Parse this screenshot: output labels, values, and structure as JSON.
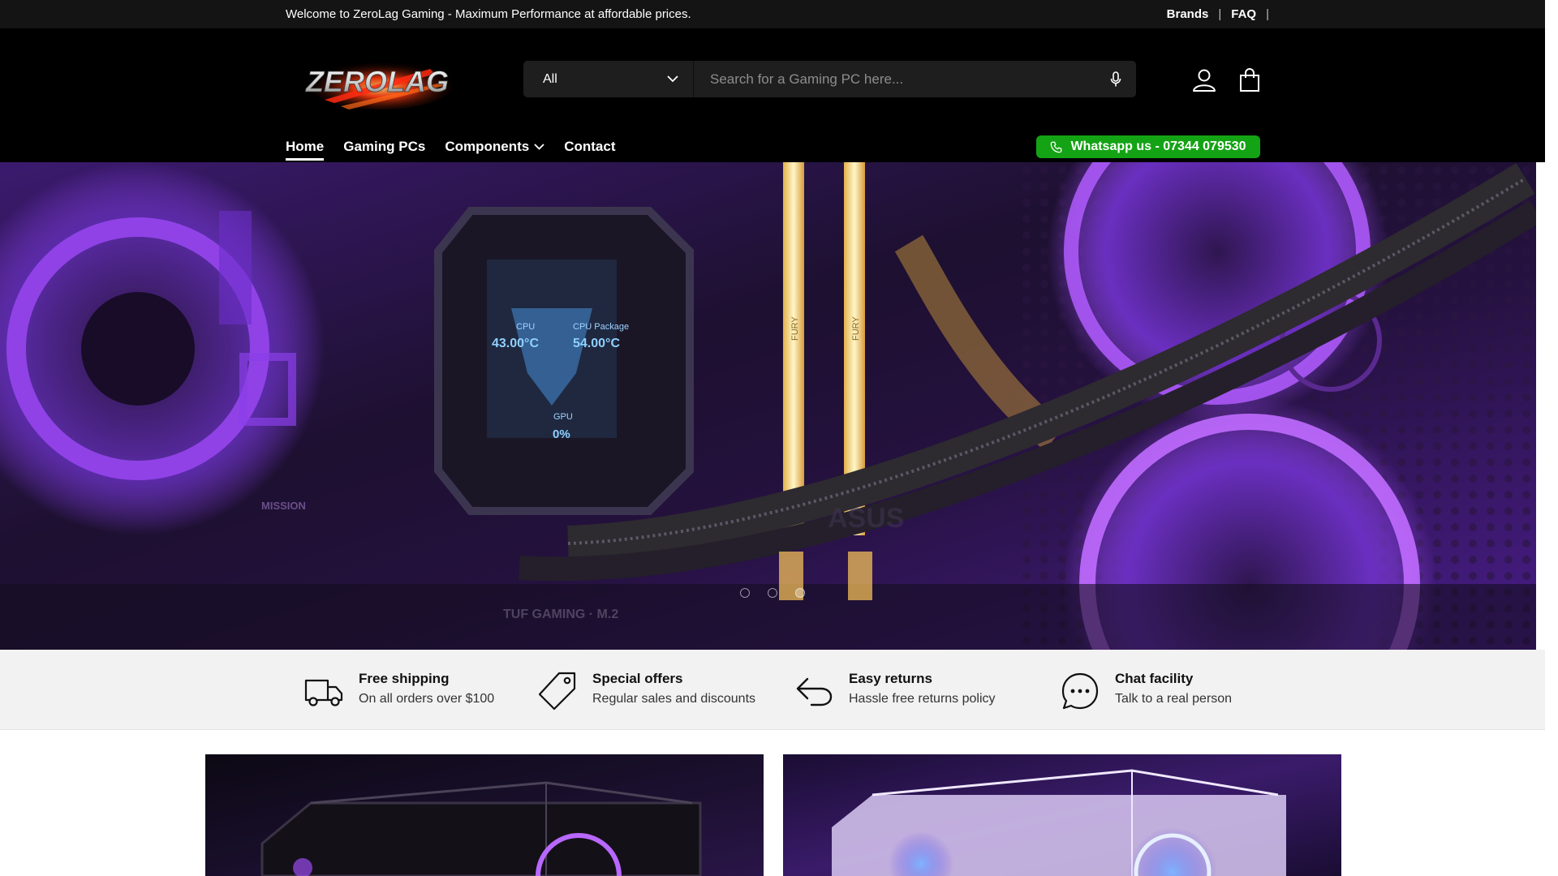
{
  "topbar": {
    "welcome": "Welcome to ZeroLag Gaming - Maximum Performance at affordable prices.",
    "links": [
      "Brands",
      "FAQ"
    ]
  },
  "brand": {
    "logo_text": "ZEROLAG",
    "accent": "#ff2a12",
    "whatsapp_green": "#14a314"
  },
  "search": {
    "category": "All",
    "placeholder": "Search for a Gaming PC here..."
  },
  "nav": {
    "items": [
      "Home",
      "Gaming PCs",
      "Components",
      "Contact"
    ],
    "active": "Home"
  },
  "whatsapp": {
    "label": "Whatsapp us - 07344 079530"
  },
  "hero": {
    "slides": 3,
    "active_slide": 3,
    "cpu_label": "CPU",
    "cpu_temp": "43.00°C",
    "package_label": "CPU Package",
    "package_temp": "54.00°C",
    "gpu_label": "GPU",
    "gpu_value": "0%",
    "ram_label": "FURY",
    "board_label": "TUF GAMING · M.2",
    "mission_label": "MISSION",
    "asus_label": "ASUS"
  },
  "features": [
    {
      "icon": "truck-icon",
      "title": "Free shipping",
      "desc": "On all orders over $100"
    },
    {
      "icon": "tag-icon",
      "title": "Special offers",
      "desc": "Regular sales and discounts"
    },
    {
      "icon": "return-arrow-icon",
      "title": "Easy returns",
      "desc": "Hassle free returns policy"
    },
    {
      "icon": "chat-icon",
      "title": "Chat facility",
      "desc": "Talk to a real person"
    }
  ]
}
